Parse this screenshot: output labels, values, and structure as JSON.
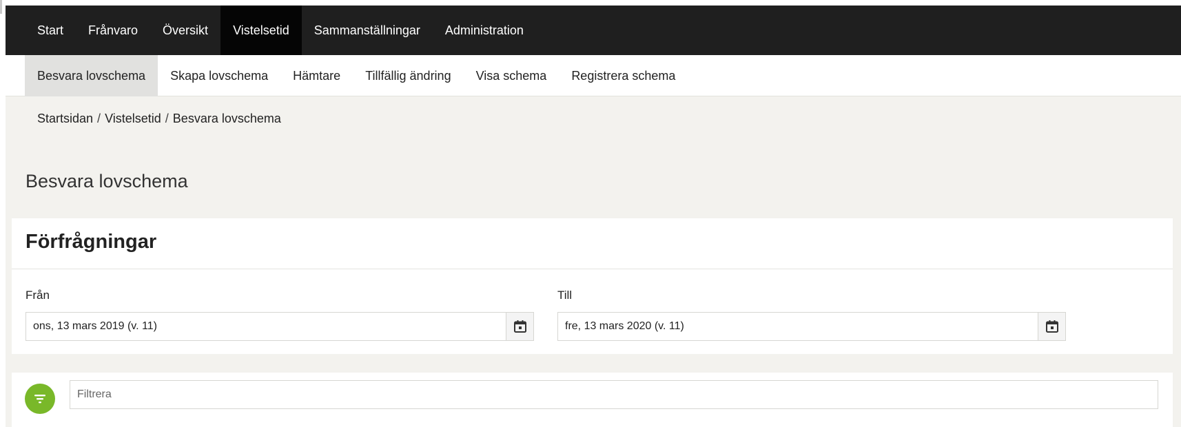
{
  "top_nav": {
    "items": [
      {
        "label": "Start"
      },
      {
        "label": "Frånvaro"
      },
      {
        "label": "Översikt"
      },
      {
        "label": "Vistelsetid",
        "active": true
      },
      {
        "label": "Sammanställningar"
      },
      {
        "label": "Administration"
      }
    ]
  },
  "sub_nav": {
    "items": [
      {
        "label": "Besvara lovschema",
        "active": true
      },
      {
        "label": "Skapa lovschema"
      },
      {
        "label": "Hämtare"
      },
      {
        "label": "Tillfällig ändring"
      },
      {
        "label": "Visa schema"
      },
      {
        "label": "Registrera schema"
      }
    ]
  },
  "breadcrumb": {
    "items": [
      "Startsidan",
      "Vistelsetid",
      "Besvara lovschema"
    ],
    "separator": "/"
  },
  "page": {
    "title": "Besvara lovschema"
  },
  "requests_card": {
    "title": "Förfrågningar",
    "from": {
      "label": "Från",
      "value": "ons, 13 mars 2019 (v. 11)",
      "icon": "calendar-icon"
    },
    "to": {
      "label": "Till",
      "value": "fre, 13 mars 2020 (v. 11)",
      "icon": "calendar-icon"
    }
  },
  "filter": {
    "placeholder": "Filtrera",
    "value": "",
    "icon": "filter-icon"
  },
  "colors": {
    "top_nav_bg": "#1f1f1f",
    "top_nav_active_bg": "#050505",
    "sub_nav_active_bg": "#e1e1df",
    "page_bg": "#f3f2ee",
    "filter_accent": "#79b829"
  }
}
